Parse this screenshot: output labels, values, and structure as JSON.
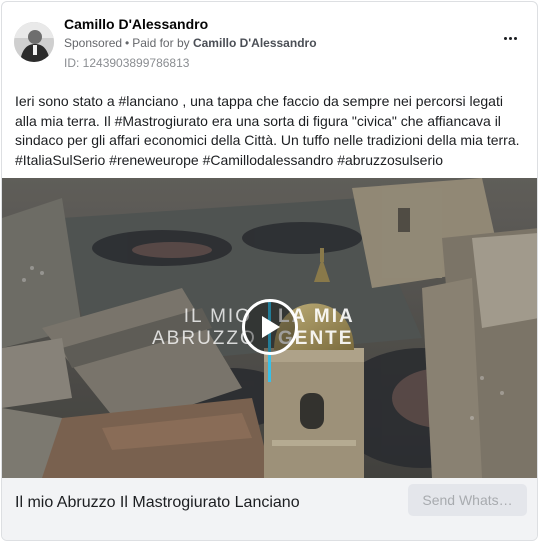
{
  "post": {
    "page_name": "Camillo D'Alessandro",
    "sponsored_label": "Sponsored",
    "separator": "•",
    "paid_for_prefix": "Paid for by",
    "paid_for_name": "Camillo D'Alessandro",
    "id_line": "ID: 1243903899786813",
    "body_text": "Ieri sono stato a #lanciano , una tappa che faccio da sempre nei percorsi legati alla mia terra. Il #Mastrogiurato era una sorta di figura \"civica\" che affiancava il sindaco per gli affari economici della Città. Un tuffo nelle tradizioni della mia terra. #ItaliaSulSerio #reneweurope #Camillodalessandro #abruzzosulserio"
  },
  "video": {
    "overlay_left_line1": "IL MIO",
    "overlay_left_line2": "ABRUZZO",
    "overlay_right_line1": "LA MIA",
    "overlay_right_line2": "GENTE",
    "play_icon": "play-icon",
    "accent_color": "#37c0e8"
  },
  "footer": {
    "title": "Il mio Abruzzo Il Mastrogiurato Lanciano",
    "cta_label": "Send Whats…"
  },
  "icons": {
    "more": "more-options-icon",
    "avatar": "profile-photo"
  }
}
